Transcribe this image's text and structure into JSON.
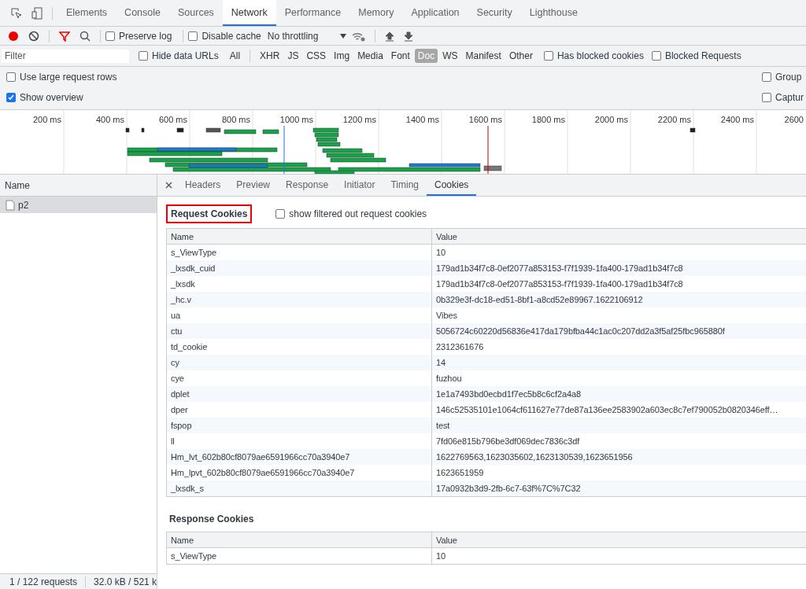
{
  "main_tabs": [
    {
      "label": "Elements",
      "selected": false
    },
    {
      "label": "Console",
      "selected": false
    },
    {
      "label": "Sources",
      "selected": false
    },
    {
      "label": "Network",
      "selected": true
    },
    {
      "label": "Performance",
      "selected": false
    },
    {
      "label": "Memory",
      "selected": false
    },
    {
      "label": "Application",
      "selected": false
    },
    {
      "label": "Security",
      "selected": false
    },
    {
      "label": "Lighthouse",
      "selected": false
    }
  ],
  "toolbar": {
    "preserve_log": {
      "label": "Preserve log",
      "checked": false
    },
    "disable_cache": {
      "label": "Disable cache",
      "checked": false
    },
    "throttling": "No throttling"
  },
  "filter_bar": {
    "placeholder": "Filter",
    "hide_data_urls": {
      "label": "Hide data URLs",
      "checked": false
    },
    "types": [
      {
        "label": "All",
        "selected": false
      },
      {
        "label": "XHR",
        "selected": false
      },
      {
        "label": "JS",
        "selected": false
      },
      {
        "label": "CSS",
        "selected": false
      },
      {
        "label": "Img",
        "selected": false
      },
      {
        "label": "Media",
        "selected": false
      },
      {
        "label": "Font",
        "selected": false
      },
      {
        "label": "Doc",
        "selected": true
      },
      {
        "label": "WS",
        "selected": false
      },
      {
        "label": "Manifest",
        "selected": false
      },
      {
        "label": "Other",
        "selected": false
      }
    ],
    "has_blocked_cookies": {
      "label": "Has blocked cookies",
      "checked": false
    },
    "blocked_requests": {
      "label": "Blocked Requests",
      "checked": false
    }
  },
  "settings": [
    {
      "label": "Use large request rows",
      "checked": false
    },
    {
      "label": "Group",
      "checked": false
    },
    {
      "label": "Show overview",
      "checked": true
    },
    {
      "label": "Captur",
      "checked": false
    }
  ],
  "overview": {
    "ticks": [
      "200 ms",
      "400 ms",
      "600 ms",
      "800 ms",
      "1000 ms",
      "1200 ms",
      "1400 ms",
      "1600 ms",
      "1800 ms",
      "2000 ms",
      "2200 ms",
      "2400 ms",
      "2600"
    ]
  },
  "request_list": {
    "column": "Name",
    "rows": [
      {
        "name": "p2",
        "selected": true
      }
    ]
  },
  "status_bar": {
    "requests": "1 / 122 requests",
    "transferred": "32.0 kB / 521 k"
  },
  "detail_tabs": [
    {
      "label": "Headers",
      "selected": false
    },
    {
      "label": "Preview",
      "selected": false
    },
    {
      "label": "Response",
      "selected": false
    },
    {
      "label": "Initiator",
      "selected": false
    },
    {
      "label": "Timing",
      "selected": false
    },
    {
      "label": "Cookies",
      "selected": true
    }
  ],
  "request_cookies": {
    "title": "Request Cookies",
    "show_filtered": {
      "label": "show filtered out request cookies",
      "checked": false
    },
    "columns": [
      "Name",
      "Value"
    ],
    "rows": [
      [
        "s_ViewType",
        "10"
      ],
      [
        "_lxsdk_cuid",
        "179ad1b34f7c8-0ef2077a853153-f7f1939-1fa400-179ad1b34f7c8"
      ],
      [
        "_lxsdk",
        "179ad1b34f7c8-0ef2077a853153-f7f1939-1fa400-179ad1b34f7c8"
      ],
      [
        "_hc.v",
        "0b329e3f-dc18-ed51-8bf1-a8cd52e89967.1622106912"
      ],
      [
        "ua",
        "Vibes"
      ],
      [
        "ctu",
        "5056724c60220d56836e417da179bfba44c1ac0c207dd2a3f5af25fbc965880f"
      ],
      [
        "td_cookie",
        "2312361676"
      ],
      [
        "cy",
        "14"
      ],
      [
        "cye",
        "fuzhou"
      ],
      [
        "dplet",
        "1e1a7493bd0ecbd1f7ec5b8c6cf2a4a8"
      ],
      [
        "dper",
        "146c52535101e1064cf611627e77de87a136ee2583902a603ec8c7ef790052b0820346eff…"
      ],
      [
        "fspop",
        "test"
      ],
      [
        "ll",
        "7fd06e815b796be3df069dec7836c3df"
      ],
      [
        "Hm_lvt_602b80cf8079ae6591966cc70a3940e7",
        "1622769563,1623035602,1623130539,1623651956"
      ],
      [
        "Hm_lpvt_602b80cf8079ae6591966cc70a3940e7",
        "1623651959"
      ],
      [
        "_lxsdk_s",
        "17a0932b3d9-2fb-6c7-63f%7C%7C32"
      ]
    ]
  },
  "response_cookies": {
    "title": "Response Cookies",
    "columns": [
      "Name",
      "Value"
    ],
    "rows": [
      [
        "s_ViewType",
        "10"
      ]
    ]
  }
}
